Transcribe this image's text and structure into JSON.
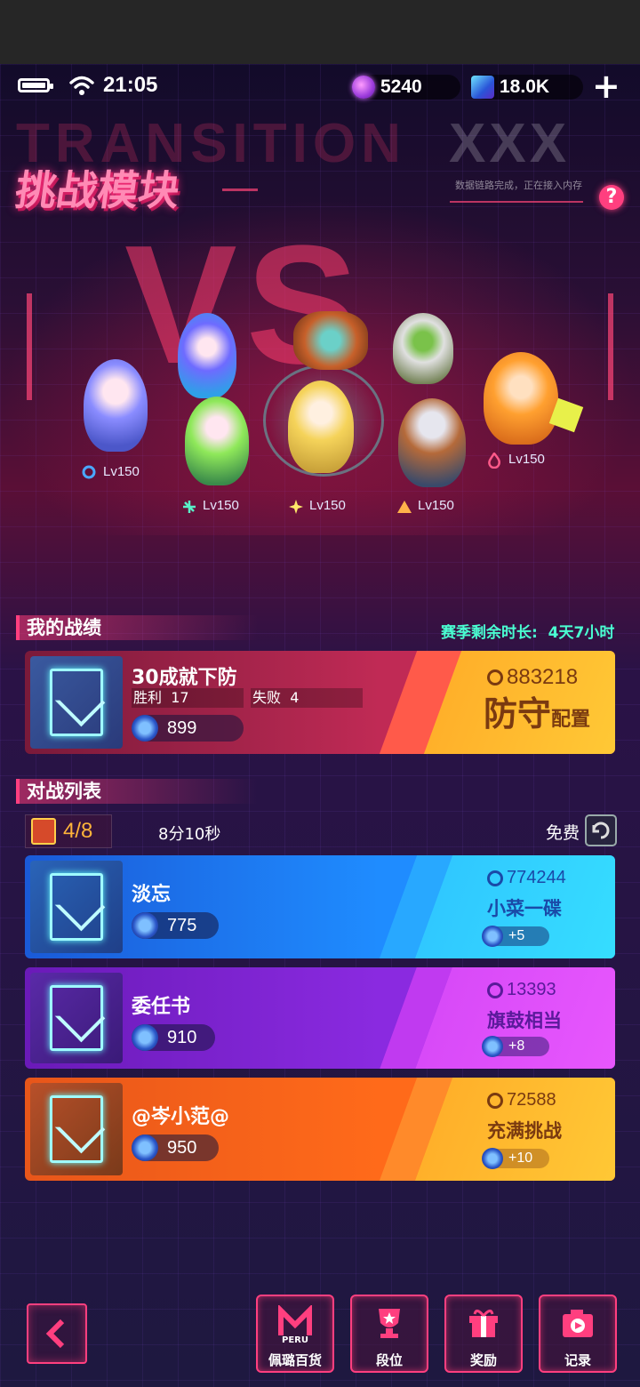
{
  "status": {
    "time": "21:05"
  },
  "currencies": [
    {
      "icon": "purple-gem-icon",
      "value": "5240"
    },
    {
      "icon": "blue-cube-icon",
      "value": "18.0K"
    }
  ],
  "banner": {
    "title": "挑战模块",
    "bg_word": "TRANSITION",
    "bg_word_right": "XXX",
    "vs": "VS",
    "small_text": "数据链路完成，正在接入内存",
    "help": "?"
  },
  "heroes": [
    {
      "level": "Lv150",
      "element": "water-icon"
    },
    {
      "level": "Lv150",
      "element": "wind-icon"
    },
    {
      "level": "Lv150",
      "element": "light-icon"
    },
    {
      "level": "Lv150",
      "element": "earth-icon"
    },
    {
      "level": "Lv150",
      "element": "fire-icon"
    }
  ],
  "my_record": {
    "header": "我的战绩",
    "season_label": "赛季剩余时长:",
    "season_value": "4天7小时",
    "name": "30成就下防",
    "win_label": "胜利",
    "win": "17",
    "lose_label": "失败",
    "lose": "4",
    "score": "899",
    "power": "883218",
    "defense": "防守",
    "config": "配置"
  },
  "battle_list": {
    "header": "对战列表",
    "count": "4/8",
    "timer": "8分10秒",
    "free": "免费",
    "items": [
      {
        "name": "淡忘",
        "score": "775",
        "power": "774244",
        "tag": "小菜一碟",
        "bonus": "+5"
      },
      {
        "name": "委任书",
        "score": "910",
        "power": "13393",
        "tag": "旗鼓相当",
        "bonus": "+8"
      },
      {
        "name": "@岑小范@",
        "score": "950",
        "power": "72588",
        "tag": "充满挑战",
        "bonus": "+10"
      }
    ]
  },
  "nav": {
    "shop": "佩璐百货",
    "shop_logo": "PERU",
    "rank": "段位",
    "reward": "奖励",
    "record": "记录"
  },
  "colors": {
    "accent": "#ff3f7f",
    "teal": "#4affd2",
    "card_blue": "#1f8cff",
    "card_purple": "#b02cf0",
    "card_orange": "#ff6a1a",
    "gold": "#ffd23a"
  }
}
